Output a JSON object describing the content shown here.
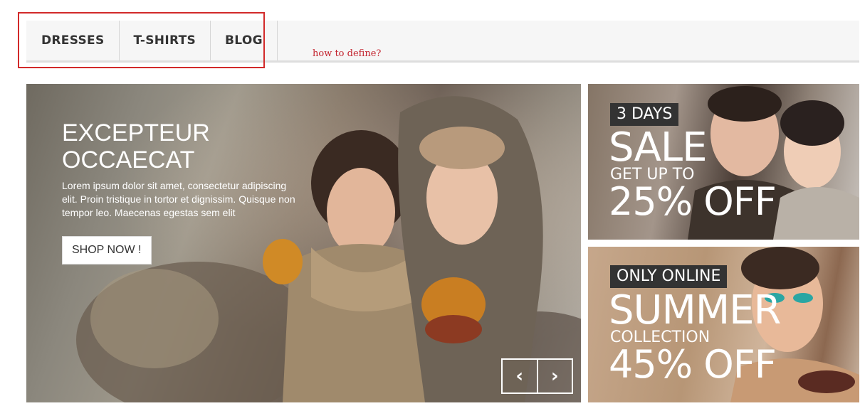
{
  "nav": {
    "items": [
      {
        "label": "DRESSES"
      },
      {
        "label": "T-SHIRTS"
      },
      {
        "label": "BLOG"
      }
    ]
  },
  "annotation": {
    "note": "how to define?",
    "highlight_color": "#d22a2a"
  },
  "slider": {
    "title_line1": "EXCEPTEUR",
    "title_line2": "OCCAECAT",
    "text": "Lorem ipsum dolor sit amet, consectetur adipiscing elit. Proin tristique in tortor et dignissim. Quisque non tempor leo. Maecenas egestas sem elit",
    "button_label": "SHOP NOW !",
    "prev_glyph": "‹",
    "next_glyph": "›"
  },
  "banner1": {
    "tag": "3 DAYS",
    "headline": "SALE",
    "subline": "GET UP TO",
    "discount": "25% OFF"
  },
  "banner2": {
    "tag": "ONLY ONLINE",
    "headline": "SUMMER",
    "subline": "COLLECTION",
    "discount": "45% OFF"
  }
}
